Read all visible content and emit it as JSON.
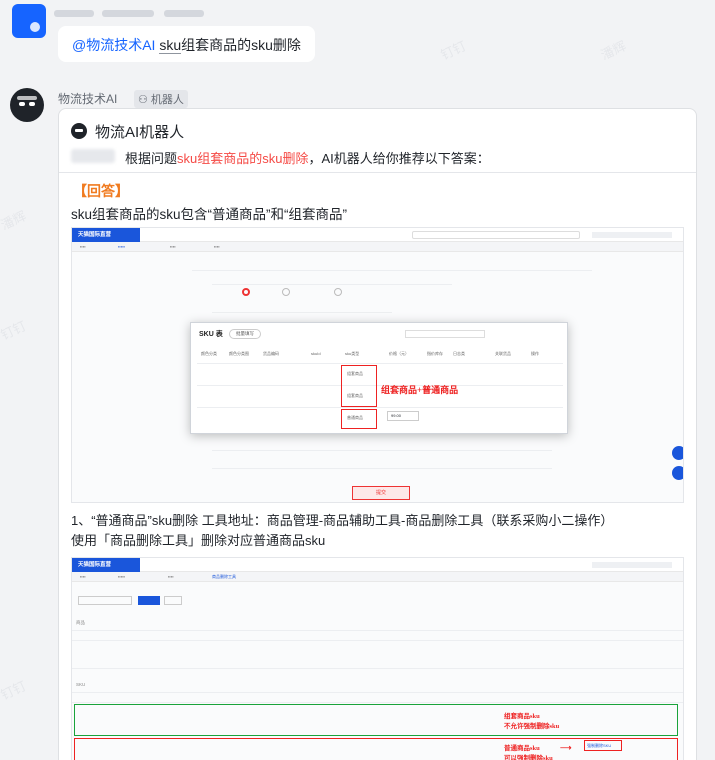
{
  "question": {
    "mention": "@物流技术AI",
    "text_before": " ",
    "underlined": "sku",
    "text_after": "组套商品的sku删除"
  },
  "bot": {
    "name": "物流技术AI",
    "tag": "机器人"
  },
  "card": {
    "title": "物流AI机器人",
    "intro_prefix": "根据问题",
    "intro_highlight": "sku组套商品的sku删除",
    "intro_suffix": "，AI机器人给你推荐以下答案：",
    "answer_label": "【回答】",
    "line1": "sku组套商品的sku包含“普通商品”和“组套商品”",
    "step1_line1": "1、“普通商品”sku删除 工具地址：商品管理-商品辅助工具-商品删除工具（联系采购小二操作）",
    "step1_line2": "使用「商品删除工具」删除对应普通商品sku"
  },
  "screenshot1": {
    "brand": "天猫国际直营",
    "dialog_title": "SKU 表",
    "dialog_btn": "批量填写",
    "headers": [
      "颜色分类",
      "颜色分类图",
      "货品编码",
      "skuId",
      "sku类型",
      "价格（元）",
      "指价库存",
      "日志类",
      "关联货品",
      "操作"
    ],
    "cell_combo": "组套商品",
    "cell_normal": "普通商品",
    "annotation": "组套商品+普通商品",
    "submit": "提交"
  },
  "screenshot2": {
    "brand": "天猫国际直营",
    "tab_active": "商品删除工具",
    "section_goods": "商品",
    "section_sku": "SKU",
    "annot_combo_1": "组套商品sku",
    "annot_combo_2": "不允许强制删除sku",
    "annot_normal_1": "普通商品sku",
    "annot_normal_2": "可以强制删除sku",
    "force_delete": "强制删除SKU"
  },
  "watermark": "钉钉 潘辉"
}
